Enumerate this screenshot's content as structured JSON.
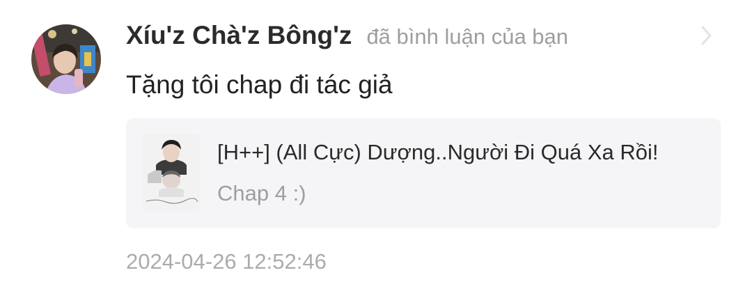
{
  "notification": {
    "avatar_icon": "user-avatar-photo",
    "username": "Xíu'z Chà'z Bông'z",
    "action": "đã bình luận của bạn",
    "chevron_icon": "chevron-right-icon",
    "comment": "Tặng tôi chap đi tác giả",
    "story": {
      "cover_icon": "story-cover-image",
      "title": "[H++] (All Cực) Dượng..Người Đi Quá Xa Rồi!",
      "chapter": "Chap 4 :)"
    },
    "timestamp": "2024-04-26 12:52:46"
  },
  "colors": {
    "background": "#ffffff",
    "username": "#2b2b2b",
    "secondary_text": "#9e9e9e",
    "card_background": "#f5f5f7"
  }
}
